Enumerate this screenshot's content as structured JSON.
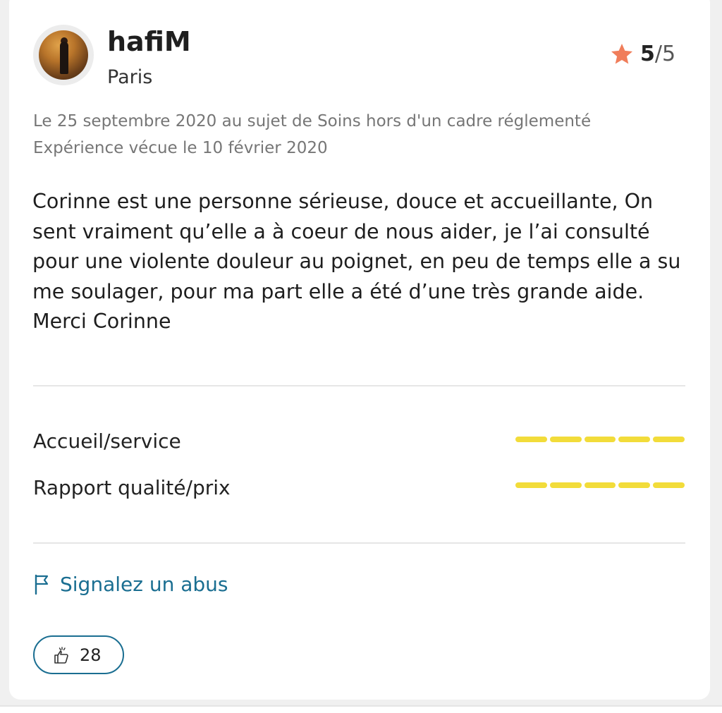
{
  "review": {
    "author": {
      "name": "hafiM",
      "city": "Paris"
    },
    "rating": {
      "score": "5",
      "separator": "/",
      "max": "5",
      "star_color": "#f07d5a"
    },
    "meta_line_1": "Le 25 septembre 2020 au sujet de Soins hors d'un cadre réglementé",
    "meta_line_2": "Expérience vécue le 10 février 2020",
    "body": "Corinne est une personne sérieuse, douce et accueillante, On sent vraiment qu’elle a à coeur de nous aider, je l’ai consulté pour une violente douleur au poignet, en peu de temps elle a su me soulager, pour ma part elle a été d’une très grande aide. Merci Corinne",
    "criteria": [
      {
        "label": "Accueil/service",
        "filled": 5,
        "total": 5
      },
      {
        "label": "Rapport qualité/prix",
        "filled": 5,
        "total": 5
      }
    ],
    "criteria_bar_color": "#f2dc3a",
    "report_label": "Signalez un abus",
    "likes": "28",
    "accent_color": "#1a6e91",
    "icons": {
      "rating": "star-icon",
      "report": "flag-icon",
      "like": "thumbs-up-icon"
    }
  }
}
